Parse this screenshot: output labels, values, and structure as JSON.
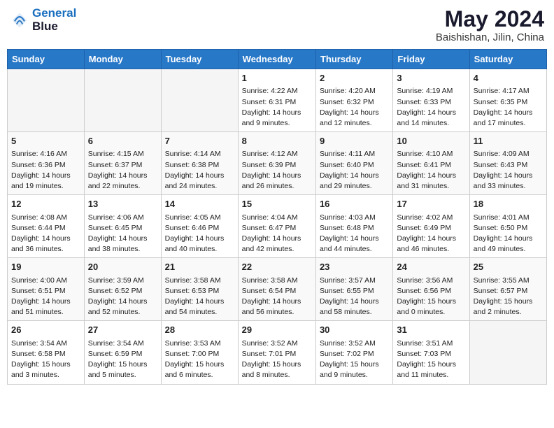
{
  "header": {
    "logo_line1": "General",
    "logo_line2": "Blue",
    "month_year": "May 2024",
    "location": "Baishishan, Jilin, China"
  },
  "weekdays": [
    "Sunday",
    "Monday",
    "Tuesday",
    "Wednesday",
    "Thursday",
    "Friday",
    "Saturday"
  ],
  "weeks": [
    [
      {
        "day": "",
        "info": ""
      },
      {
        "day": "",
        "info": ""
      },
      {
        "day": "",
        "info": ""
      },
      {
        "day": "1",
        "info": "Sunrise: 4:22 AM\nSunset: 6:31 PM\nDaylight: 14 hours\nand 9 minutes."
      },
      {
        "day": "2",
        "info": "Sunrise: 4:20 AM\nSunset: 6:32 PM\nDaylight: 14 hours\nand 12 minutes."
      },
      {
        "day": "3",
        "info": "Sunrise: 4:19 AM\nSunset: 6:33 PM\nDaylight: 14 hours\nand 14 minutes."
      },
      {
        "day": "4",
        "info": "Sunrise: 4:17 AM\nSunset: 6:35 PM\nDaylight: 14 hours\nand 17 minutes."
      }
    ],
    [
      {
        "day": "5",
        "info": "Sunrise: 4:16 AM\nSunset: 6:36 PM\nDaylight: 14 hours\nand 19 minutes."
      },
      {
        "day": "6",
        "info": "Sunrise: 4:15 AM\nSunset: 6:37 PM\nDaylight: 14 hours\nand 22 minutes."
      },
      {
        "day": "7",
        "info": "Sunrise: 4:14 AM\nSunset: 6:38 PM\nDaylight: 14 hours\nand 24 minutes."
      },
      {
        "day": "8",
        "info": "Sunrise: 4:12 AM\nSunset: 6:39 PM\nDaylight: 14 hours\nand 26 minutes."
      },
      {
        "day": "9",
        "info": "Sunrise: 4:11 AM\nSunset: 6:40 PM\nDaylight: 14 hours\nand 29 minutes."
      },
      {
        "day": "10",
        "info": "Sunrise: 4:10 AM\nSunset: 6:41 PM\nDaylight: 14 hours\nand 31 minutes."
      },
      {
        "day": "11",
        "info": "Sunrise: 4:09 AM\nSunset: 6:43 PM\nDaylight: 14 hours\nand 33 minutes."
      }
    ],
    [
      {
        "day": "12",
        "info": "Sunrise: 4:08 AM\nSunset: 6:44 PM\nDaylight: 14 hours\nand 36 minutes."
      },
      {
        "day": "13",
        "info": "Sunrise: 4:06 AM\nSunset: 6:45 PM\nDaylight: 14 hours\nand 38 minutes."
      },
      {
        "day": "14",
        "info": "Sunrise: 4:05 AM\nSunset: 6:46 PM\nDaylight: 14 hours\nand 40 minutes."
      },
      {
        "day": "15",
        "info": "Sunrise: 4:04 AM\nSunset: 6:47 PM\nDaylight: 14 hours\nand 42 minutes."
      },
      {
        "day": "16",
        "info": "Sunrise: 4:03 AM\nSunset: 6:48 PM\nDaylight: 14 hours\nand 44 minutes."
      },
      {
        "day": "17",
        "info": "Sunrise: 4:02 AM\nSunset: 6:49 PM\nDaylight: 14 hours\nand 46 minutes."
      },
      {
        "day": "18",
        "info": "Sunrise: 4:01 AM\nSunset: 6:50 PM\nDaylight: 14 hours\nand 49 minutes."
      }
    ],
    [
      {
        "day": "19",
        "info": "Sunrise: 4:00 AM\nSunset: 6:51 PM\nDaylight: 14 hours\nand 51 minutes."
      },
      {
        "day": "20",
        "info": "Sunrise: 3:59 AM\nSunset: 6:52 PM\nDaylight: 14 hours\nand 52 minutes."
      },
      {
        "day": "21",
        "info": "Sunrise: 3:58 AM\nSunset: 6:53 PM\nDaylight: 14 hours\nand 54 minutes."
      },
      {
        "day": "22",
        "info": "Sunrise: 3:58 AM\nSunset: 6:54 PM\nDaylight: 14 hours\nand 56 minutes."
      },
      {
        "day": "23",
        "info": "Sunrise: 3:57 AM\nSunset: 6:55 PM\nDaylight: 14 hours\nand 58 minutes."
      },
      {
        "day": "24",
        "info": "Sunrise: 3:56 AM\nSunset: 6:56 PM\nDaylight: 15 hours\nand 0 minutes."
      },
      {
        "day": "25",
        "info": "Sunrise: 3:55 AM\nSunset: 6:57 PM\nDaylight: 15 hours\nand 2 minutes."
      }
    ],
    [
      {
        "day": "26",
        "info": "Sunrise: 3:54 AM\nSunset: 6:58 PM\nDaylight: 15 hours\nand 3 minutes."
      },
      {
        "day": "27",
        "info": "Sunrise: 3:54 AM\nSunset: 6:59 PM\nDaylight: 15 hours\nand 5 minutes."
      },
      {
        "day": "28",
        "info": "Sunrise: 3:53 AM\nSunset: 7:00 PM\nDaylight: 15 hours\nand 6 minutes."
      },
      {
        "day": "29",
        "info": "Sunrise: 3:52 AM\nSunset: 7:01 PM\nDaylight: 15 hours\nand 8 minutes."
      },
      {
        "day": "30",
        "info": "Sunrise: 3:52 AM\nSunset: 7:02 PM\nDaylight: 15 hours\nand 9 minutes."
      },
      {
        "day": "31",
        "info": "Sunrise: 3:51 AM\nSunset: 7:03 PM\nDaylight: 15 hours\nand 11 minutes."
      },
      {
        "day": "",
        "info": ""
      }
    ]
  ]
}
